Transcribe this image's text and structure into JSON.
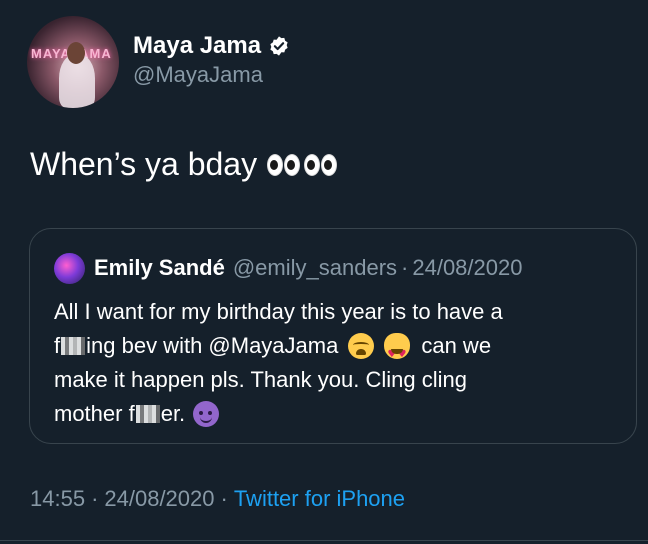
{
  "author": {
    "display_name": "Maya Jama",
    "handle": "@MayaJama",
    "verified": true,
    "avatar_neon_text": "MAYAJAMA"
  },
  "tweet": {
    "text": "When’s ya bday",
    "emoji": "eyes-eyes"
  },
  "quoted": {
    "display_name": "Emily Sandé",
    "handle": "@emily_sanders",
    "separator": "·",
    "date": "24/08/2020",
    "lines": [
      {
        "before": "All I want for my birthday this year is to have a"
      },
      {
        "before": "f",
        "after_censor": "ing bev with @MayaJama",
        "tail": "can we"
      },
      {
        "before": "make it happen pls. Thank you. Cling cling"
      },
      {
        "before": "mother f",
        "after_censor": "er."
      }
    ]
  },
  "meta": {
    "time": "14:55",
    "separator": "·",
    "date": "24/08/2020",
    "source": "Twitter for iPhone"
  },
  "colors": {
    "background": "#15202b",
    "secondary_text": "#8899a6",
    "link": "#1da1f2",
    "border": "#38444d"
  }
}
